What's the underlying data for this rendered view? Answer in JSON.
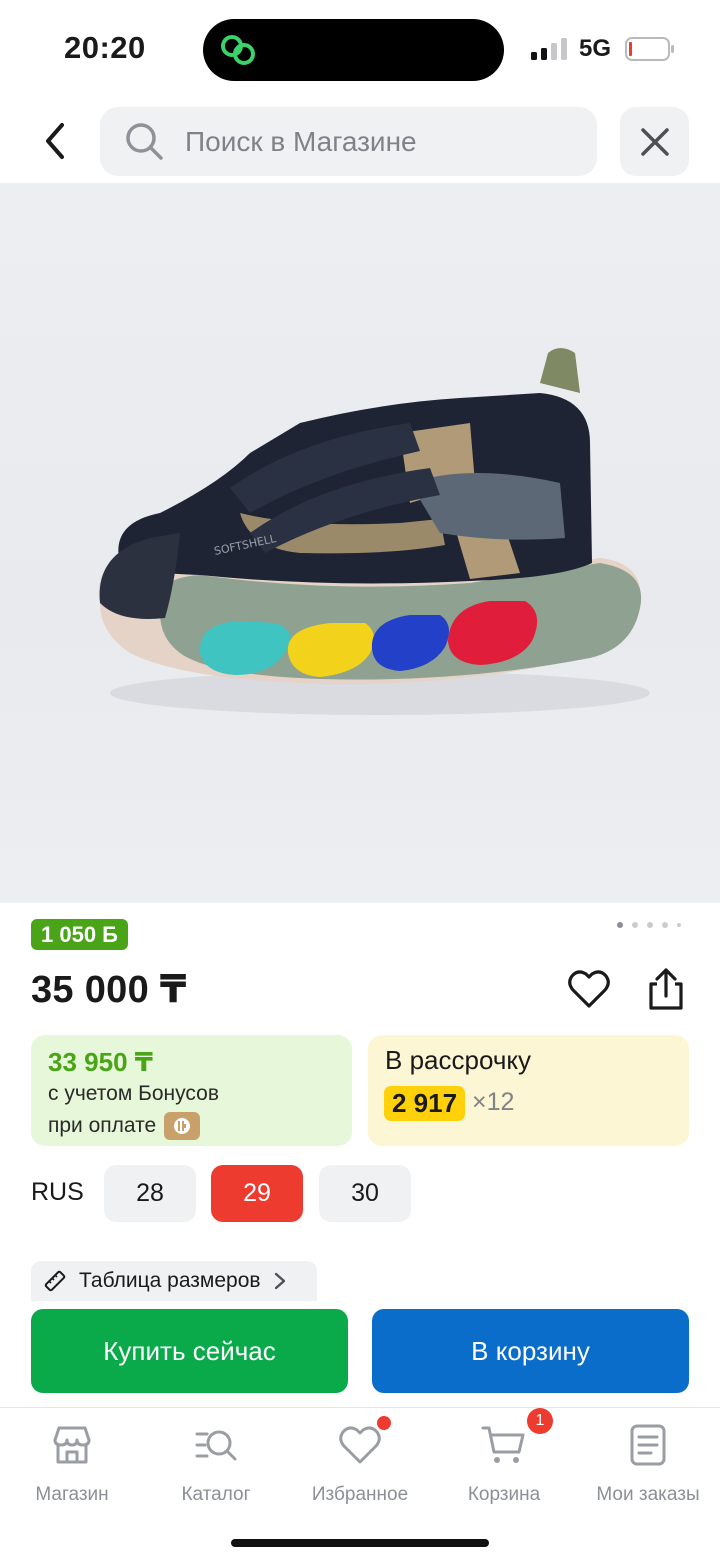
{
  "status_bar": {
    "time": "20:20",
    "network": "5G"
  },
  "search": {
    "placeholder": "Поиск в Магазине"
  },
  "product": {
    "bonus_badge": "1 050 Б",
    "price": "35 000 ₸",
    "bonus_price": "33 950 ₸",
    "bonus_note_line1": "с учетом Бонусов",
    "bonus_note_line2": "при оплате",
    "installment_label": "В рассрочку",
    "installment_amount": "2 917",
    "installment_times": "×12",
    "image_label": "SOFTSHELL",
    "gallery": {
      "total": 5,
      "active": 1
    }
  },
  "sizes": {
    "system": "RUS",
    "options": [
      "28",
      "29",
      "30"
    ],
    "selected": "29",
    "table_label": "Таблица размеров"
  },
  "actions": {
    "buy_now": "Купить сейчас",
    "add_to_cart": "В корзину"
  },
  "nav": {
    "items": [
      {
        "label": "Магазин",
        "icon": "store-icon"
      },
      {
        "label": "Каталог",
        "icon": "catalog-search-icon"
      },
      {
        "label": "Избранное",
        "icon": "heart-icon"
      },
      {
        "label": "Корзина",
        "icon": "cart-icon"
      },
      {
        "label": "Мои заказы",
        "icon": "orders-icon"
      }
    ],
    "cart_count": "1"
  },
  "colors": {
    "green": "#0aaa4b",
    "blue": "#0a6dc9",
    "red": "#ee3b30",
    "bonus_green": "#4aa418",
    "yellow": "#ffd10a"
  }
}
